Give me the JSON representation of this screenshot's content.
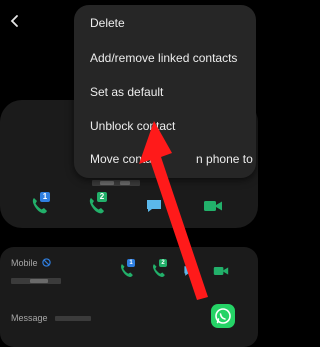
{
  "menu": {
    "items": [
      {
        "label": "Delete"
      },
      {
        "label": "Add/remove linked contacts"
      },
      {
        "label": "Set as default"
      },
      {
        "label": "Unblock contact"
      },
      {
        "label": "Move contac"
      },
      {
        "label": "n phone to"
      }
    ]
  },
  "details": {
    "mobile_label": "Mobile",
    "message_label": "Message"
  },
  "actions": {
    "sim1_badge": "1",
    "sim2_badge": "2"
  },
  "colors": {
    "call_green": "#22b06a",
    "badge_blue": "#2f7fe0",
    "message_blue": "#5bb8ea",
    "video_green": "#22b06a",
    "whatsapp_green": "#25d366",
    "arrow_red": "#ff1a1a"
  }
}
